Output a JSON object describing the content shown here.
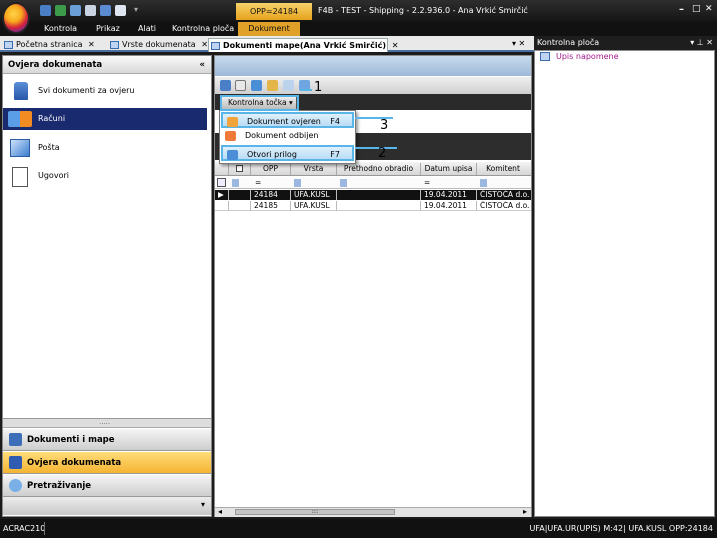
{
  "app": {
    "opp_title": "OPP=24184",
    "title": "F4B - TEST - Shipping - 2.2.936.0 - Ana  Vrkić Smirčić",
    "win_min": "–",
    "win_max": "□",
    "win_close": "✕"
  },
  "menu": [
    "Kontrola",
    "Prikaz",
    "Alati",
    "Kontrolna ploča",
    "Dokument"
  ],
  "tabs": [
    {
      "label": "Početna stranica"
    },
    {
      "label": "Vrste dokumenata"
    },
    {
      "label": "Dokumenti mape(Ana Vrkić Smirčić)"
    }
  ],
  "tab_close": "✕",
  "left_panel": {
    "title": "Ovjera dokumenata",
    "collapse": "«",
    "items": [
      {
        "label": "Svi dokumenti za ovjeru",
        "icon": "stamp-icon"
      },
      {
        "label": "Računi",
        "icon": "invoice-arrow-icon"
      },
      {
        "label": "Pošta",
        "icon": "envelope-icon"
      },
      {
        "label": "Ugovori",
        "icon": "contract-document-icon"
      }
    ],
    "splitter": ".....",
    "bottom_buttons": [
      {
        "label": "Dokumenti i mape"
      },
      {
        "label": "Ovjera dokumenata"
      },
      {
        "label": "Pretraživanje"
      }
    ],
    "bottom_arrow": "▾"
  },
  "center": {
    "pane_controls": "▾ ✕",
    "toolbar_dropdown": "Kontrolna točka ▾",
    "dropdown_items": [
      {
        "label": "Dokument ovjeren",
        "key": "F4"
      },
      {
        "label": "Dokument odbijen",
        "key": ""
      },
      {
        "label": "Otvori prilog",
        "key": "F7"
      }
    ],
    "callouts": [
      "1",
      "3",
      "2"
    ],
    "columns": [
      "OPP",
      "Vrsta",
      "Prethodno obradio",
      "Datum upisa",
      "Komitent"
    ],
    "filter_row": {
      "opp": "=",
      "date": "="
    },
    "rows": [
      {
        "opp": "24184",
        "vrsta": "UFA.KUSL",
        "prethodno": "",
        "datum": "19.04.2011",
        "komitent": "ČISTOĆA d.o.",
        "selected": true,
        "marker": "▶"
      },
      {
        "opp": "24185",
        "vrsta": "UFA.KUSL",
        "prethodno": "",
        "datum": "19.04.2011",
        "komitent": "ČISTOĆA d.o.",
        "selected": false,
        "marker": ""
      }
    ],
    "hscroll": {
      "left": "◂",
      "right": "▸",
      "grip": "::::"
    }
  },
  "right_panel": {
    "title": "Kontrolna ploča",
    "controls": "▾ ⊥ ✕",
    "link": "Upis napomene"
  },
  "statusbar": {
    "left": "ACRAC210",
    "right": "UFA|UFA.UR(UPIS) M:42| UFA.KUSL OPP:24184"
  },
  "colors": {
    "accent": "#e0a128",
    "selection": "#1a2a6e",
    "highlight": "#59b5e8"
  }
}
